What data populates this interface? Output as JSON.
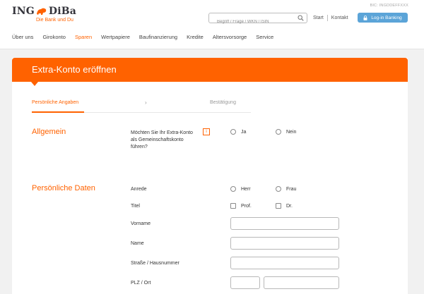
{
  "header": {
    "logo_text_left": "ING",
    "logo_text_right": "DiBa",
    "logo_tagline": "Die Bank und Du",
    "bic": "BIC: INGDDEFFXXX",
    "search_placeholder": "Begriff / Frage / WKN / ISIN",
    "links": [
      "Start",
      "Kontakt"
    ],
    "login_label": "Log-in Banking"
  },
  "nav": {
    "items": [
      {
        "label": "Über uns",
        "active": false
      },
      {
        "label": "Girokonto",
        "active": false
      },
      {
        "label": "Sparen",
        "active": true
      },
      {
        "label": "Wertpapiere",
        "active": false
      },
      {
        "label": "Baufinanzierung",
        "active": false
      },
      {
        "label": "Kredite",
        "active": false
      },
      {
        "label": "Altersvorsorge",
        "active": false
      },
      {
        "label": "Service",
        "active": false
      }
    ]
  },
  "page": {
    "title": "Extra-Konto eröffnen",
    "steps": [
      "Persönliche Angaben",
      "›",
      "Bestätigung"
    ]
  },
  "allgemein": {
    "title": "Allgemein",
    "question": "Möchten Sie Ihr Extra-Konto als Gemeinschaftskonto führen?",
    "info": "i",
    "options": [
      "Ja",
      "Nein"
    ]
  },
  "personal": {
    "title": "Persönliche Daten",
    "anrede_label": "Anrede",
    "anrede_options": [
      "Herr",
      "Frau"
    ],
    "titel_label": "Titel",
    "titel_options": [
      "Prof.",
      "Dr."
    ],
    "vorname_label": "Vorname",
    "vorname_value": "",
    "name_label": "Name",
    "name_value": "",
    "strasse_label": "Straße / Hausnummer",
    "strasse_value": "",
    "plz_label": "PLZ / Ort",
    "plz_value": "",
    "ort_value": ""
  },
  "colors": {
    "brand_orange": "#ff6200",
    "login_blue": "#5ba4d8"
  }
}
